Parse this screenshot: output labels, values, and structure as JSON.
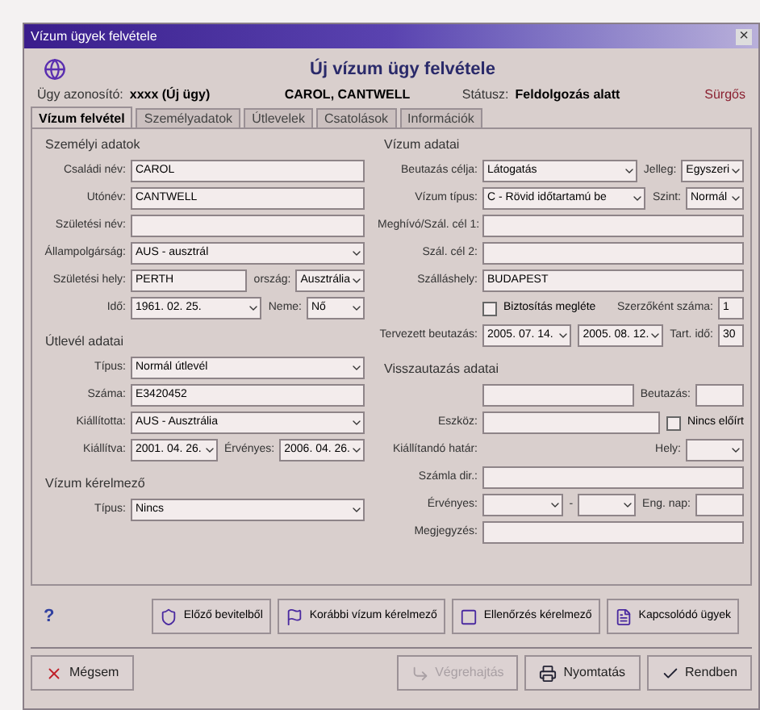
{
  "window": {
    "title": "Vízum ügyek felvétele",
    "close": "×"
  },
  "header": {
    "title": "Új vízum ügy felvétele",
    "case_label": "Ügy azonosító:",
    "case_id": "xxxx (Új ügy)",
    "name": "CAROL, CANTWELL",
    "status_label": "Státusz:",
    "status": "Feldolgozás alatt",
    "flag": "Sürgős"
  },
  "tabs": [
    {
      "label": "Vízum felvétel",
      "selected": true
    },
    {
      "label": "Személyadatok",
      "selected": false
    },
    {
      "label": "Útlevelek",
      "selected": false
    },
    {
      "label": "Csatolások",
      "selected": false
    },
    {
      "label": "Információk",
      "selected": false
    }
  ],
  "left_sections": [
    {
      "title": "Személyi adatok",
      "rows": [
        [
          {
            "kind": "text",
            "label": "Családi név:",
            "value": "CAROL"
          }
        ],
        [
          {
            "kind": "text",
            "label": "Utónév:",
            "value": "CANTWELL"
          }
        ],
        [
          {
            "kind": "text",
            "label": "Születési név:"
          }
        ],
        [
          {
            "kind": "select",
            "label": "Állampolgárság:",
            "value": "AUS - ausztrál"
          }
        ],
        [
          {
            "kind": "text",
            "label": "Születési hely:",
            "value": "PERTH"
          },
          {
            "kind": "select",
            "label": "ország:",
            "value": "Ausztrália"
          }
        ],
        [
          {
            "kind": "select",
            "label": "Idő:",
            "value": "1961. 02. 25."
          },
          {
            "kind": "select",
            "label": "Neme:",
            "value": "Nő"
          }
        ]
      ]
    },
    {
      "title": "Útlevél adatai",
      "rows": [
        [
          {
            "kind": "select",
            "label": "Típus:",
            "value": "Normál útlevél"
          }
        ],
        [
          {
            "kind": "text",
            "label": "Száma:",
            "value": "E3420452"
          }
        ],
        [
          {
            "kind": "select",
            "label": "Kiállította:",
            "value": "AUS - Ausztrália"
          }
        ],
        [
          {
            "kind": "select",
            "label": "Kiállítva:",
            "value": "2001. 04. 26."
          },
          {
            "kind": "select",
            "label": "Érvényes:",
            "value": "2006. 04. 26."
          }
        ]
      ]
    },
    {
      "title": "Vízum kérelmező",
      "rows": [
        [
          {
            "kind": "select",
            "label": "Típus:",
            "value": "Nincs"
          }
        ]
      ]
    }
  ],
  "right_sections": [
    {
      "title": "Vízum adatai",
      "rows": [
        [
          {
            "kind": "select",
            "label": "Beutazás célja:",
            "value": "Látogatás"
          },
          {
            "kind": "select",
            "label": "Jelleg:",
            "value": "Egyszeri"
          }
        ],
        [
          {
            "kind": "select",
            "label": "Vízum típus:",
            "value": "C - Rövid időtartamú be"
          },
          {
            "kind": "select",
            "label": "Szint:",
            "value": "Normál"
          }
        ],
        [
          {
            "kind": "text",
            "label": "Meghívó/Szál. cél 1:"
          }
        ],
        [
          {
            "kind": "text",
            "label": "Szál. cél 2:"
          }
        ],
        [
          {
            "kind": "text",
            "label": "Szálláshely:",
            "value": "BUDAPEST"
          }
        ],
        [
          {
            "kind": "check",
            "label": "Biztosítás megléte",
            "checked": false
          },
          {
            "kind": "text",
            "label": "Szerzőként száma:",
            "value": "1"
          }
        ],
        [
          {
            "kind": "select",
            "label": "Tervezett beutazás:",
            "value": "2005. 07. 14."
          },
          {
            "kind": "select",
            "value": "2005. 08. 12."
          },
          {
            "kind": "text",
            "label": "Tart. idő:",
            "value": "30"
          }
        ]
      ]
    },
    {
      "title": "Visszautazás adatai",
      "rows": [
        [
          {
            "kind": "text"
          },
          {
            "kind": "text",
            "label": "Beutazás:"
          }
        ],
        [
          {
            "kind": "text",
            "label": "Eszköz:"
          },
          {
            "kind": "check",
            "label": "Nincs előírt",
            "checked": false
          }
        ],
        [
          {
            "kind": "spacer",
            "label": "Kiállítandó határ:"
          },
          {
            "kind": "select",
            "label": "Hely:"
          }
        ],
        [
          {
            "kind": "text",
            "label": "Számla dir.:"
          }
        ],
        [
          {
            "kind": "select",
            "label": "Érvényes:"
          },
          {
            "kind": "select",
            "label": "-"
          },
          {
            "kind": "text",
            "label": "Eng. nap:"
          }
        ],
        [
          {
            "kind": "text",
            "label": "Megjegyzés:"
          }
        ]
      ]
    }
  ],
  "help": "?",
  "action_buttons": [
    {
      "label": "Előző bevitelből"
    },
    {
      "label": "Korábbi vízum kérelmező"
    },
    {
      "label": "Ellenőrzés kérelmező"
    },
    {
      "label": "Kapcsolódó ügyek"
    }
  ],
  "footer_buttons": [
    {
      "label": "Mégsem",
      "disabled": false
    },
    {
      "label": "Végrehajtás",
      "disabled": true
    },
    {
      "label": "Nyomtatás",
      "disabled": false
    },
    {
      "label": "Rendben",
      "disabled": false
    }
  ]
}
